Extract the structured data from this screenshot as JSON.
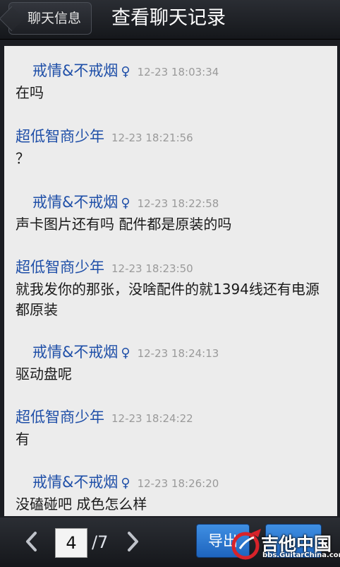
{
  "header": {
    "back_label": "聊天信息",
    "title": "查看聊天记录"
  },
  "messages": [
    {
      "sender": "戒情&不戒烟",
      "symbol": "♀",
      "time": "12-23 18:03:34",
      "text": "在吗",
      "side": "other"
    },
    {
      "sender": "超低智商少年",
      "symbol": "",
      "time": "12-23 18:21:56",
      "text": "？",
      "side": "self"
    },
    {
      "sender": "戒情&不戒烟",
      "symbol": "♀",
      "time": "12-23 18:22:58",
      "text": "声卡图片还有吗 配件都是原装的吗",
      "side": "other"
    },
    {
      "sender": "超低智商少年",
      "symbol": "",
      "time": "12-23 18:23:50",
      "text": "就我发你的那张，没啥配件的就1394线还有电源都原装",
      "side": "self"
    },
    {
      "sender": "戒情&不戒烟",
      "symbol": "♀",
      "time": "12-23 18:24:13",
      "text": "驱动盘呢",
      "side": "other"
    },
    {
      "sender": "超低智商少年",
      "symbol": "",
      "time": "12-23 18:24:22",
      "text": "有",
      "side": "self"
    },
    {
      "sender": "戒情&不戒烟",
      "symbol": "♀",
      "time": "12-23 18:26:20",
      "text": "没磕碰吧 成色怎么样",
      "side": "other"
    }
  ],
  "footer": {
    "page_current": "4",
    "page_total": "/7",
    "prev_icon": "‹",
    "next_icon": "›",
    "export_label": "导出"
  },
  "watermark": {
    "title": "吉他中国",
    "url": "bbs.GuitarChina.com"
  },
  "colors": {
    "sender": "#1f4fa8",
    "time": "#9a9a9a",
    "button": "#2a78d6",
    "background": "#ececec"
  }
}
